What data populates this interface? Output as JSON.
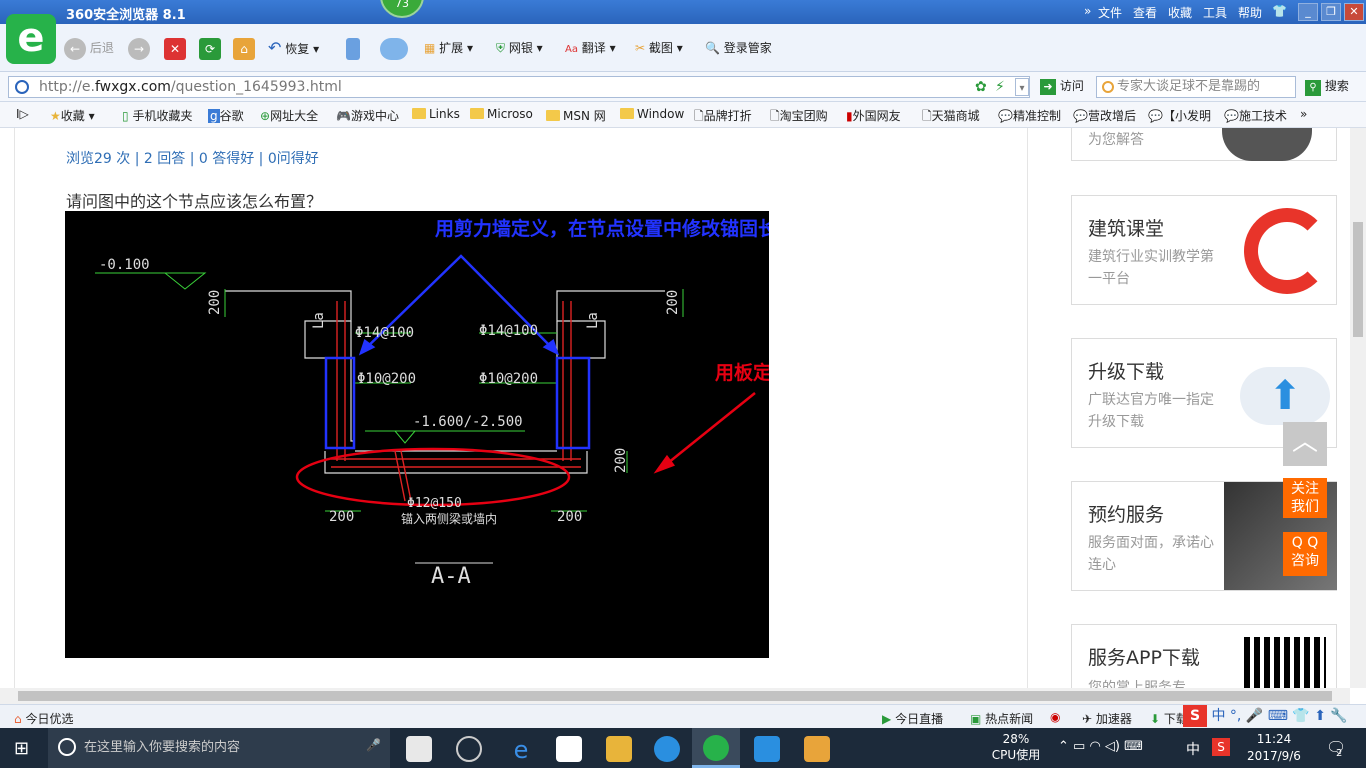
{
  "browser": {
    "title": "360安全浏览器 8.1",
    "badge": "73",
    "menus": [
      "文件",
      "查看",
      "收藏",
      "工具",
      "帮助"
    ],
    "toolbar": {
      "back": "后退",
      "restore": "恢复",
      "extend": "扩展",
      "netbank": "网银",
      "translate": "翻译",
      "screenshot": "截图",
      "login": "登录管家"
    },
    "address": {
      "url_prefix": "http://e.",
      "url_domain": "fwxgx.com",
      "url_path": "/question_1645993.html",
      "visit": "访问",
      "search_placeholder": "专家大谈足球不是靠踢的",
      "search": "搜索"
    },
    "bookmarks": [
      "收藏",
      "手机收藏夹",
      "谷歌",
      "网址大全",
      "游戏中心",
      "Links",
      "Microso",
      "MSN 网",
      "Window",
      "品牌打折",
      "淘宝团购",
      "外国网友",
      "天猫商城",
      "精准控制",
      "营改增后",
      "【小发明",
      "施工技术"
    ]
  },
  "page": {
    "stats": "浏览29 次 | 2 回答 | 0 答得好 | 0问得好",
    "question": "请问图中的这个节点应该怎么布置？",
    "cad": {
      "blue_note": "用剪力墙定义，在节点设置中修改锚固长度",
      "red_note": "用板定义",
      "elev_top": "-0.100",
      "elev_bottom": "-1.600/-2.500",
      "rebar_l1": "Φ14@100",
      "rebar_r1": "Φ14@100",
      "rebar_l2": "Φ10@200",
      "rebar_r2": "Φ10@200",
      "rebar_bottom": "Φ12@150",
      "anchor_note": "锚入两侧梁或墙内",
      "dim_200": "200",
      "la": "La",
      "section": "A-A"
    },
    "sidebar": [
      {
        "title": "",
        "desc": "为您解答"
      },
      {
        "title": "建筑课堂",
        "desc": "建筑行业实训教学第一平台"
      },
      {
        "title": "升级下载",
        "desc": "广联达官方唯一指定升级下载"
      },
      {
        "title": "预约服务",
        "desc": "服务面对面，承诺心连心"
      },
      {
        "title": "服务APP下载",
        "desc": "您的掌上服务专"
      }
    ],
    "float": {
      "follow": "关注我们",
      "qq": "Q Q咨询"
    }
  },
  "statusbar": {
    "left": "今日优选",
    "live": "今日直播",
    "news": "热点新闻",
    "speed": "加速器",
    "download": "下载"
  },
  "taskbar": {
    "search_placeholder": "在这里输入你要搜索的内容",
    "cpu": "28%",
    "cpu_label": "CPU使用",
    "ime": "中",
    "time": "11:24",
    "date": "2017/9/6",
    "notif": "2"
  },
  "colors": {
    "accent": "#2a64bb",
    "red": "#e60012",
    "blue_note": "#2233ff",
    "orange": "#ff6600"
  }
}
